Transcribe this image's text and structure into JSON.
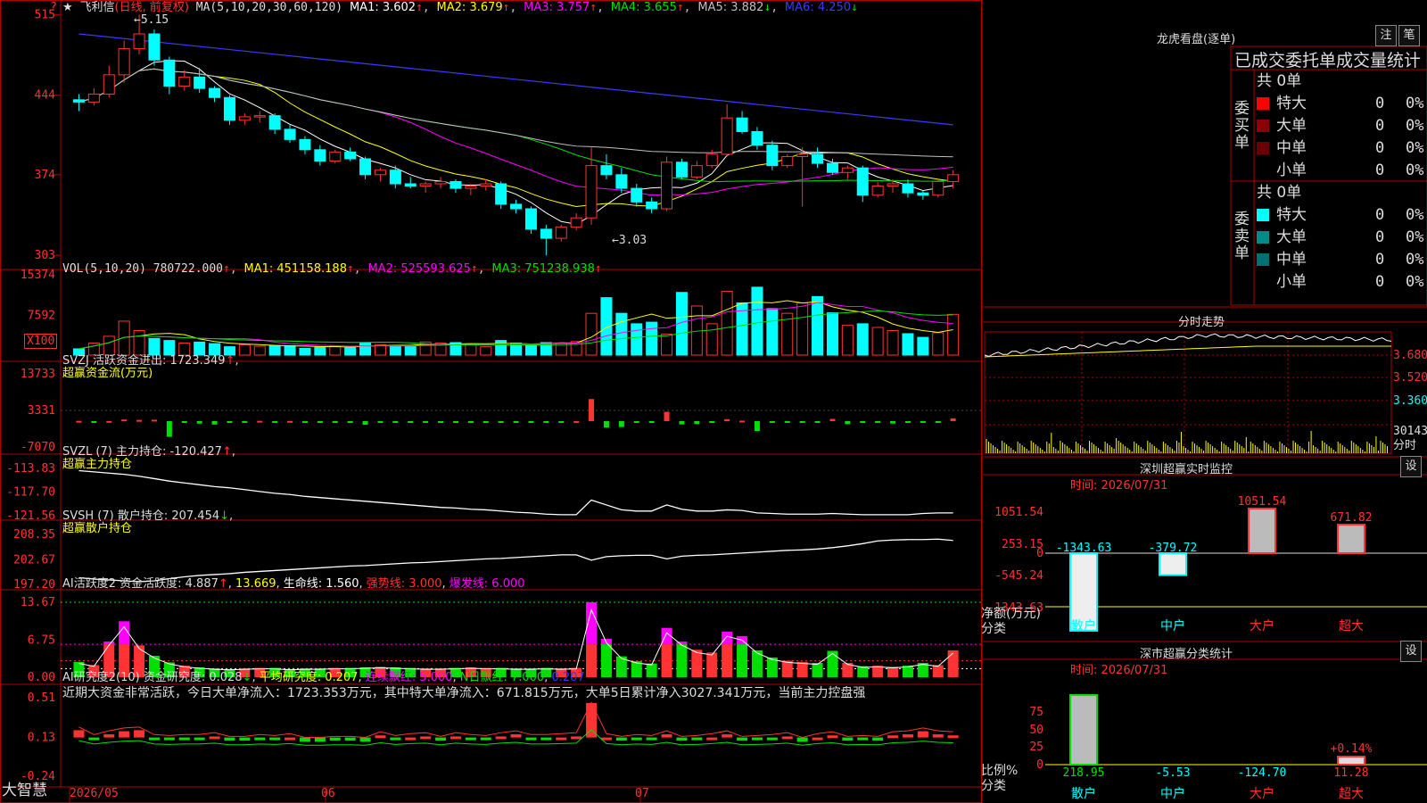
{
  "stock": {
    "star": "★",
    "name": "飞利信",
    "period": "(日线, 前复权)"
  },
  "colors": {
    "up": "#ff3333",
    "down": "#00ffff",
    "green": "#00e000",
    "grid": "#b00000",
    "yellow": "#ffff00",
    "magenta": "#ff00ff",
    "white": "#ffffff"
  },
  "kline": {
    "ma_params": "MA(5,10,20,30,60,120)",
    "indicators": [
      {
        "label": "MA1: 3.602",
        "arrow": "↑",
        "color": "#ffffff"
      },
      {
        "label": "MA2: 3.679",
        "arrow": "↑",
        "color": "#ffff00"
      },
      {
        "label": "MA3: 3.757",
        "arrow": "↑",
        "color": "#ff00ff"
      },
      {
        "label": "MA4: 3.655",
        "arrow": "↑",
        "color": "#00e000"
      },
      {
        "label": "MA5: 3.882",
        "arrow": "↓",
        "color": "#c0c0c0"
      },
      {
        "label": "MA6: 4.250",
        "arrow": "↓",
        "color": "#3a3aff"
      }
    ],
    "y_ticks": [
      "515",
      "444",
      "374",
      "303"
    ],
    "high_label": "5.15",
    "low_label": "3.03",
    "corner_mark": "?"
  },
  "vol": {
    "title": "VOL(5,10,20) 780722.000",
    "indicators": [
      {
        "label": "MA1: 451158.188",
        "arrow": "↑",
        "color": "#ffff00"
      },
      {
        "label": "MA2: 525593.625",
        "arrow": "↑",
        "color": "#ff00ff"
      },
      {
        "label": "MA3: 751238.938",
        "arrow": "↑",
        "color": "#00e000"
      }
    ],
    "y_ticks": [
      "15374",
      "7592"
    ],
    "unit": "X100"
  },
  "svzj": {
    "title": "SVZJ  活跃资金进出: 1723.349",
    "subtitle": "超赢资金流(万元)",
    "y_ticks": [
      "13733",
      "3331",
      "-7070"
    ]
  },
  "svzl": {
    "title": "SVZL (7) 主力持仓: -120.427",
    "subtitle": "超赢主力持仓",
    "y_ticks": [
      "-113.83",
      "-117.70",
      "-121.56"
    ]
  },
  "svsh": {
    "title": "SVSH (7) 散户持仓: 207.454",
    "subtitle": "超赢散户持仓",
    "y_ticks": [
      "208.35",
      "202.67",
      "197.20"
    ]
  },
  "ai_act": {
    "title": "AI活跃度2 资金活跃度: 4.887",
    "indicators": [
      {
        "label": "13.669",
        "color": "#ffff00"
      },
      {
        "label": "生命线: 1.560",
        "color": "#ffffff"
      },
      {
        "label": "强势线: 3.000",
        "color": "#ff3333"
      },
      {
        "label": "爆发线: 6.000",
        "color": "#ff00ff"
      }
    ],
    "y_ticks": [
      "13.67",
      "6.75",
      "0.00"
    ]
  },
  "ai_res": {
    "title": "AI研究度2(10) 资金研究度: 0.028",
    "indicators": [
      {
        "label": "平均研究度: 0.207",
        "color": "#ffff00"
      },
      {
        "label": "连续飘红: 5.000",
        "color": "#ff00ff"
      },
      {
        "label": "N日飘红: 7.000",
        "color": "#00e000"
      },
      {
        "label": "0.207",
        "color": "#3a3aff"
      }
    ],
    "comment": "近期大资金非常活跃，今日大单净流入：1723.353万元，其中特大单净流入：671.815万元，大单5日累计净入3027.341万元，当前主力控盘强",
    "y_ticks": [
      "0.51",
      "0.13",
      "-0.24"
    ]
  },
  "bottom": {
    "brand": "大智慧",
    "dates": [
      "2026/05",
      "06",
      "07"
    ]
  },
  "longhu": {
    "title": "龙虎看盘(逐单)",
    "buttons": [
      "注",
      "笔"
    ],
    "header": "已成交委托单成交量统计",
    "buy": {
      "label": "委买单",
      "total": "共 0单",
      "rows": [
        {
          "name": "特大",
          "count": "0",
          "pct": "0%",
          "color": "#ff0000"
        },
        {
          "name": "大单",
          "count": "0",
          "pct": "0%",
          "color": "#8b0000"
        },
        {
          "name": "中单",
          "count": "0",
          "pct": "0%",
          "color": "#6a0000"
        },
        {
          "name": "小单",
          "count": "0",
          "pct": "0%",
          "color": "#000000"
        }
      ]
    },
    "sell": {
      "label": "委卖单",
      "total": "共 0单",
      "rows": [
        {
          "name": "特大",
          "count": "0",
          "pct": "0%",
          "color": "#00ffff"
        },
        {
          "name": "大单",
          "count": "0",
          "pct": "0%",
          "color": "#008b8b"
        },
        {
          "name": "中单",
          "count": "0",
          "pct": "0%",
          "color": "#007070"
        },
        {
          "name": "小单",
          "count": "0",
          "pct": "0%",
          "color": "#000000"
        }
      ]
    }
  },
  "intraday": {
    "title": "分时走势",
    "y_ticks": [
      "3.680",
      "3.520",
      "3.360"
    ],
    "vol_tick": "30143",
    "vol_unit": "分时"
  },
  "monitor": {
    "title": "深圳超赢实时监控",
    "btn": "设",
    "time": "时间: 2026/07/31",
    "y_ticks": [
      "1051.54",
      "253.15",
      "0",
      "-545.24",
      "-1343.63"
    ],
    "axis_label1": "净额(万元)",
    "axis_label2": "分类",
    "categories": [
      "散户",
      "中户",
      "大户",
      "超大"
    ],
    "values": [
      -1343.63,
      -379.72,
      1051.54,
      671.82
    ],
    "value_labels": [
      "-1343.63",
      "-379.72",
      "1051.54",
      "671.82"
    ]
  },
  "classify": {
    "title": "深市超赢分类统计",
    "btn": "设",
    "time": "时间: 2026/07/31",
    "y_ticks": [
      "75",
      "50",
      "25",
      "0"
    ],
    "axis_label1": "比例%",
    "axis_label2": "分类",
    "categories": [
      "散户",
      "中户",
      "大户",
      "超大"
    ],
    "values": [
      218.95,
      -5.53,
      -124.7,
      11.28
    ],
    "value_labels": [
      "218.95",
      "-5.53",
      "-124.70",
      "11.28"
    ],
    "top_label": "+0.14%"
  },
  "chart_data": {
    "type": "candlestick",
    "title": "飞利信 (日线, 前复权)",
    "ylim": [
      3.0,
      5.2
    ],
    "x_labels": [
      "2026/05",
      "06",
      "07"
    ],
    "ohlc": [
      [
        4.4,
        4.45,
        4.3,
        4.38
      ],
      [
        4.38,
        4.5,
        4.35,
        4.45
      ],
      [
        4.45,
        4.7,
        4.42,
        4.62
      ],
      [
        4.62,
        4.92,
        4.55,
        4.85
      ],
      [
        4.85,
        5.15,
        4.8,
        4.98
      ],
      [
        4.98,
        5.02,
        4.7,
        4.75
      ],
      [
        4.75,
        4.78,
        4.45,
        4.52
      ],
      [
        4.52,
        4.66,
        4.48,
        4.6
      ],
      [
        4.6,
        4.68,
        4.46,
        4.5
      ],
      [
        4.5,
        4.52,
        4.38,
        4.42
      ],
      [
        4.42,
        4.44,
        4.18,
        4.22
      ],
      [
        4.22,
        4.28,
        4.18,
        4.25
      ],
      [
        4.25,
        4.3,
        4.2,
        4.26
      ],
      [
        4.26,
        4.28,
        4.1,
        4.14
      ],
      [
        4.14,
        4.18,
        4.02,
        4.05
      ],
      [
        4.05,
        4.08,
        3.92,
        3.96
      ],
      [
        3.96,
        4.0,
        3.82,
        3.86
      ],
      [
        3.86,
        3.96,
        3.84,
        3.94
      ],
      [
        3.94,
        3.98,
        3.86,
        3.88
      ],
      [
        3.88,
        3.9,
        3.7,
        3.74
      ],
      [
        3.74,
        3.8,
        3.68,
        3.78
      ],
      [
        3.78,
        3.82,
        3.62,
        3.66
      ],
      [
        3.66,
        3.72,
        3.62,
        3.64
      ],
      [
        3.64,
        3.68,
        3.58,
        3.66
      ],
      [
        3.66,
        3.72,
        3.62,
        3.68
      ],
      [
        3.68,
        3.7,
        3.58,
        3.62
      ],
      [
        3.62,
        3.66,
        3.56,
        3.64
      ],
      [
        3.64,
        3.7,
        3.6,
        3.66
      ],
      [
        3.66,
        3.68,
        3.44,
        3.48
      ],
      [
        3.48,
        3.52,
        3.4,
        3.44
      ],
      [
        3.44,
        3.46,
        3.22,
        3.26
      ],
      [
        3.26,
        3.3,
        3.03,
        3.18
      ],
      [
        3.18,
        3.3,
        3.15,
        3.28
      ],
      [
        3.28,
        3.4,
        3.25,
        3.36
      ],
      [
        3.36,
        3.98,
        3.3,
        3.82
      ],
      [
        3.82,
        3.92,
        3.7,
        3.74
      ],
      [
        3.74,
        3.8,
        3.58,
        3.62
      ],
      [
        3.62,
        3.66,
        3.46,
        3.5
      ],
      [
        3.5,
        3.54,
        3.4,
        3.44
      ],
      [
        3.44,
        3.9,
        3.42,
        3.85
      ],
      [
        3.85,
        3.88,
        3.7,
        3.72
      ],
      [
        3.72,
        3.86,
        3.7,
        3.82
      ],
      [
        3.82,
        3.96,
        3.8,
        3.92
      ],
      [
        3.92,
        4.36,
        3.9,
        4.24
      ],
      [
        4.24,
        4.3,
        4.1,
        4.12
      ],
      [
        4.12,
        4.16,
        3.96,
        4.0
      ],
      [
        4.0,
        4.04,
        3.78,
        3.82
      ],
      [
        3.82,
        3.92,
        3.8,
        3.9
      ],
      [
        3.9,
        3.98,
        3.46,
        3.92
      ],
      [
        3.92,
        3.98,
        3.8,
        3.84
      ],
      [
        3.84,
        3.88,
        3.74,
        3.76
      ],
      [
        3.76,
        3.82,
        3.7,
        3.8
      ],
      [
        3.8,
        3.82,
        3.5,
        3.56
      ],
      [
        3.56,
        3.68,
        3.54,
        3.64
      ],
      [
        3.64,
        3.7,
        3.58,
        3.66
      ],
      [
        3.66,
        3.7,
        3.54,
        3.58
      ],
      [
        3.58,
        3.6,
        3.52,
        3.56
      ],
      [
        3.56,
        3.7,
        3.54,
        3.68
      ],
      [
        3.68,
        3.78,
        3.62,
        3.74
      ]
    ],
    "volume": [
      1200,
      2300,
      3600,
      6500,
      4700,
      3200,
      2800,
      2300,
      2500,
      2200,
      1600,
      2000,
      1700,
      1800,
      1800,
      1300,
      1500,
      1700,
      1500,
      2400,
      2000,
      1800,
      1700,
      2500,
      2300,
      2400,
      2100,
      1600,
      2800,
      2300,
      1900,
      2400,
      2300,
      2600,
      8000,
      11000,
      8000,
      6000,
      6300,
      4000,
      12000,
      9400,
      6000,
      12200,
      10000,
      13000,
      8900,
      8000,
      10000,
      11200,
      8100,
      5700,
      6000,
      5300,
      4700,
      4100,
      3400,
      4300,
      7800
    ],
    "svzj": [
      60,
      -20,
      30,
      330,
      240,
      290,
      -3200,
      -150,
      -500,
      -700,
      -250,
      -120,
      60,
      -140,
      40,
      -180,
      -60,
      -150,
      -220,
      -750,
      -80,
      -300,
      -140,
      -180,
      -120,
      -50,
      -210,
      -30,
      -60,
      -150,
      -100,
      -120,
      -80,
      10,
      4500,
      -1300,
      -1200,
      -200,
      -180,
      1900,
      -660,
      -590,
      -130,
      400,
      100,
      -2000,
      -350,
      -200,
      -200,
      -350,
      450,
      -600,
      -200,
      -230,
      -500,
      -210,
      -160,
      -150,
      560
    ],
    "svzl": [
      -114.2,
      -114.4,
      -114.6,
      -114.8,
      -115.1,
      -115.5,
      -115.9,
      -116.2,
      -116.5,
      -116.8,
      -117.0,
      -117.3,
      -117.6,
      -117.9,
      -118.1,
      -118.4,
      -118.6,
      -118.8,
      -119.0,
      -119.2,
      -119.4,
      -119.6,
      -119.8,
      -120.0,
      -120.2,
      -120.3,
      -120.5,
      -120.6,
      -120.8,
      -121.0,
      -121.1,
      -121.3,
      -121.4,
      -121.4,
      -119.0,
      -119.8,
      -120.6,
      -120.8,
      -120.8,
      -119.8,
      -120.5,
      -120.8,
      -120.8,
      -120.6,
      -120.7,
      -121.1,
      -121.2,
      -121.3,
      -121.3,
      -121.3,
      -121.2,
      -121.3,
      -121.4,
      -121.4,
      -121.4,
      -121.4,
      -121.2,
      -121.1,
      -121.1
    ],
    "svsh": [
      198.7,
      198.4,
      198.2,
      198.0,
      197.8,
      198.0,
      198.5,
      198.9,
      199.2,
      199.4,
      199.6,
      199.9,
      200.1,
      200.3,
      200.5,
      200.7,
      200.9,
      201.1,
      201.3,
      201.4,
      201.6,
      201.8,
      202.0,
      202.1,
      202.3,
      202.5,
      202.7,
      202.9,
      203.0,
      203.2,
      203.4,
      203.6,
      203.8,
      203.8,
      202.6,
      203.4,
      203.6,
      203.7,
      203.7,
      202.9,
      203.5,
      203.7,
      203.8,
      204.0,
      204.2,
      204.4,
      204.6,
      204.8,
      204.9,
      205.1,
      205.4,
      205.8,
      206.3,
      206.9,
      207.1,
      207.2,
      207.2,
      207.3,
      207.0
    ],
    "ai_act": [
      2.8,
      2.2,
      6.5,
      10.2,
      5.8,
      3.9,
      2.7,
      2.1,
      1.8,
      1.6,
      1.5,
      1.6,
      1.7,
      1.7,
      1.5,
      1.6,
      1.6,
      1.7,
      1.7,
      1.8,
      1.9,
      1.8,
      1.7,
      1.6,
      1.6,
      1.7,
      1.8,
      1.7,
      1.7,
      1.6,
      1.6,
      1.7,
      1.6,
      1.7,
      13.67,
      7.0,
      3.8,
      2.9,
      2.5,
      9.0,
      6.5,
      5.0,
      4.5,
      8.3,
      7.5,
      4.9,
      3.6,
      3.0,
      2.8,
      2.6,
      4.8,
      2.6,
      2.0,
      2.1,
      1.9,
      2.1,
      2.6,
      2.2,
      4.9
    ],
    "ai_res": [
      0.2,
      0.12,
      0.16,
      0.19,
      0.2,
      0.12,
      0.11,
      0.12,
      0.12,
      0.14,
      0.1,
      0.1,
      0.12,
      0.11,
      0.13,
      0.09,
      0.09,
      0.1,
      0.1,
      0.09,
      0.15,
      0.11,
      0.13,
      0.14,
      0.1,
      0.14,
      0.12,
      0.11,
      0.14,
      0.16,
      0.12,
      0.12,
      0.13,
      0.14,
      0.46,
      0.13,
      0.1,
      0.12,
      0.11,
      0.16,
      0.1,
      0.11,
      0.13,
      0.16,
      0.1,
      0.11,
      0.12,
      0.14,
      0.09,
      0.13,
      0.15,
      0.1,
      0.11,
      0.1,
      0.15,
      0.16,
      0.19,
      0.16,
      0.15
    ]
  }
}
